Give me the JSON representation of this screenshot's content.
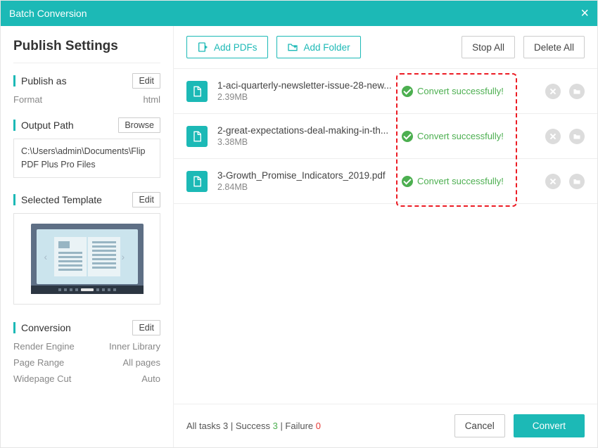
{
  "window": {
    "title": "Batch Conversion"
  },
  "sidebar": {
    "heading": "Publish Settings",
    "publish_as": {
      "title": "Publish as",
      "edit": "Edit",
      "format_label": "Format",
      "format_value": "html"
    },
    "output_path": {
      "title": "Output Path",
      "browse": "Browse",
      "path": "C:\\Users\\admin\\Documents\\Flip PDF Plus Pro Files"
    },
    "template": {
      "title": "Selected Template",
      "edit": "Edit"
    },
    "conversion": {
      "title": "Conversion",
      "edit": "Edit",
      "rows": [
        {
          "label": "Render Engine",
          "value": "Inner Library"
        },
        {
          "label": "Page Range",
          "value": "All pages"
        },
        {
          "label": "Widepage Cut",
          "value": "Auto"
        }
      ]
    }
  },
  "toolbar": {
    "add_pdfs": "Add PDFs",
    "add_folder": "Add Folder",
    "stop_all": "Stop All",
    "delete_all": "Delete All"
  },
  "files": [
    {
      "name": "1-aci-quarterly-newsletter-issue-28-new...",
      "size": "2.39MB",
      "status": "Convert successfully!"
    },
    {
      "name": "2-great-expectations-deal-making-in-th...",
      "size": "3.38MB",
      "status": "Convert successfully!"
    },
    {
      "name": "3-Growth_Promise_Indicators_2019.pdf",
      "size": "2.84MB",
      "status": "Convert successfully!"
    }
  ],
  "footer": {
    "summary_prefix": "All tasks ",
    "total": "3",
    "sep1": " | Success ",
    "success": "3",
    "sep2": " | Failure ",
    "failure": "0",
    "cancel": "Cancel",
    "convert": "Convert"
  },
  "colors": {
    "teal": "#1cb9b6",
    "green": "#4caf50",
    "red": "#e53935"
  }
}
